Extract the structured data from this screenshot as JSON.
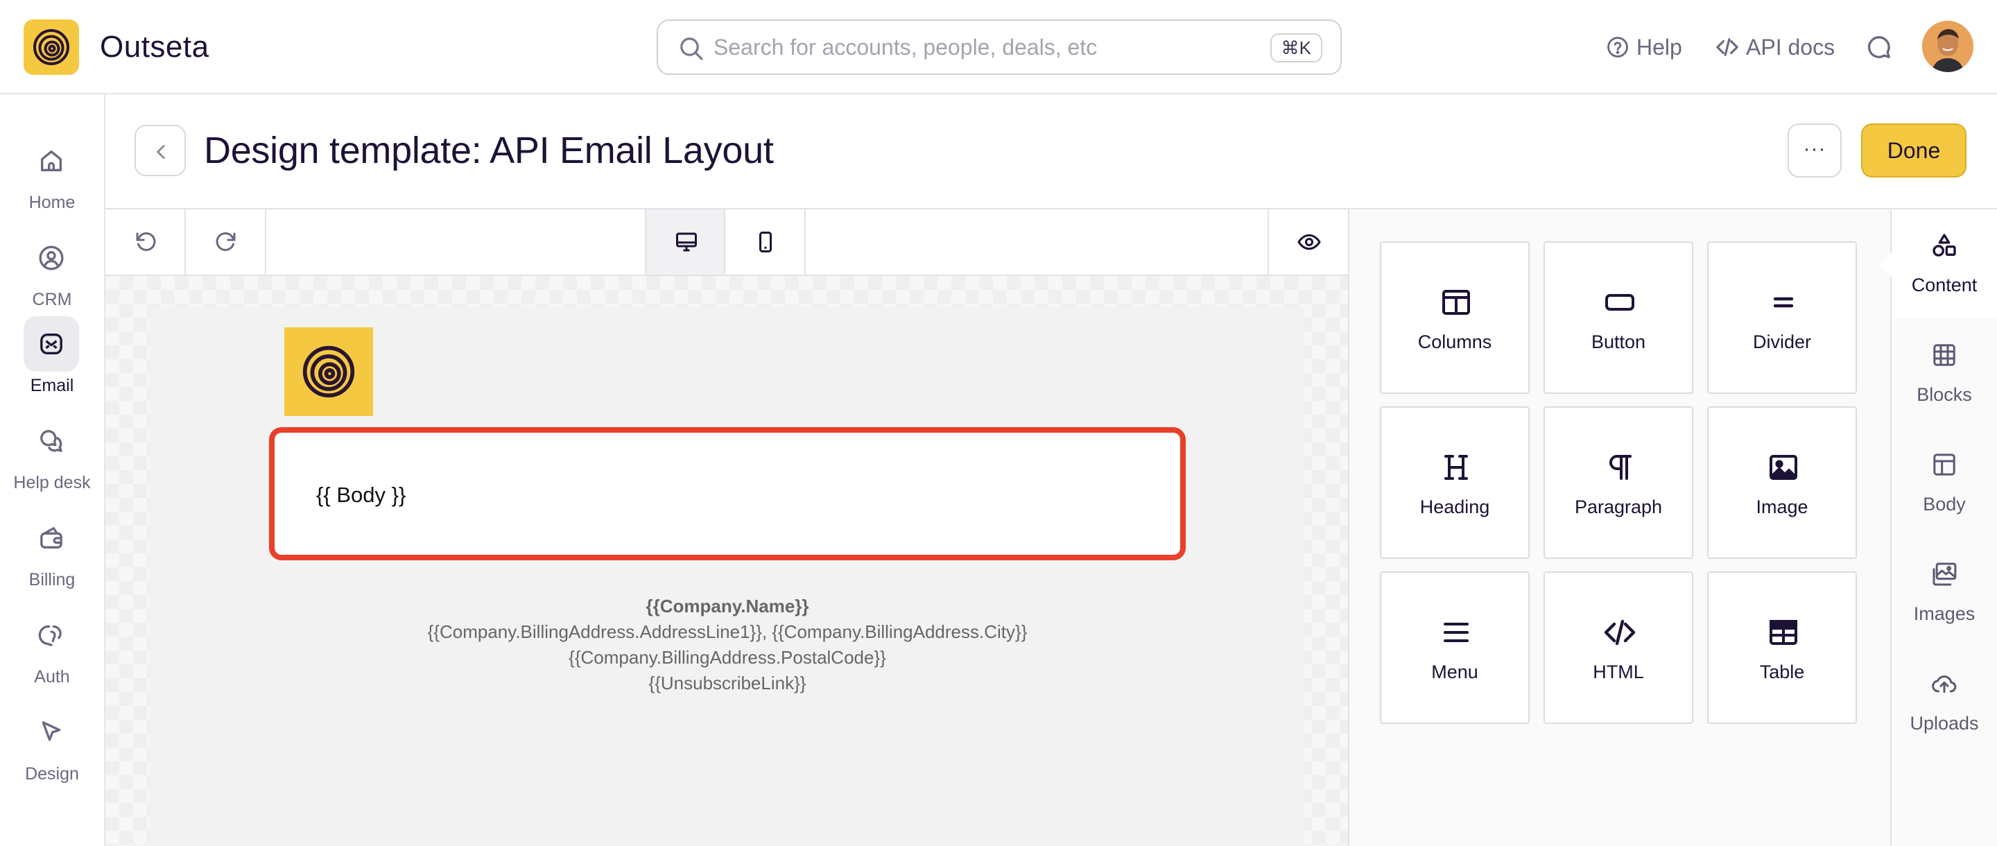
{
  "app": {
    "name": "Outseta",
    "logo_icon": "outseta-logo-icon"
  },
  "search": {
    "placeholder": "Search for accounts, people, deals, etc",
    "shortcut": "⌘K"
  },
  "top_links": {
    "help": "Help",
    "api_docs": "API docs"
  },
  "nav": {
    "items": [
      {
        "label": "Home",
        "icon": "home-icon"
      },
      {
        "label": "CRM",
        "icon": "crm-icon"
      },
      {
        "label": "Email",
        "icon": "email-icon",
        "active": true
      },
      {
        "label": "Help desk",
        "icon": "help-desk-icon"
      },
      {
        "label": "Billing",
        "icon": "billing-icon"
      },
      {
        "label": "Auth",
        "icon": "auth-icon"
      },
      {
        "label": "Design",
        "icon": "design-icon"
      }
    ]
  },
  "page": {
    "title": "Design template: API Email Layout",
    "more_label": "···",
    "done_label": "Done"
  },
  "editor": {
    "view_mode": "desktop",
    "body_placeholder": "{{ Body }}",
    "footer": {
      "company_name": "{{Company.Name}}",
      "address_line": "{{Company.BillingAddress.AddressLine1}}, {{Company.BillingAddress.City}}",
      "postal_code": "{{Company.BillingAddress.PostalCode}}",
      "unsubscribe": "{{UnsubscribeLink}}"
    }
  },
  "content_tiles": [
    {
      "label": "Columns",
      "icon": "columns-icon"
    },
    {
      "label": "Button",
      "icon": "button-icon"
    },
    {
      "label": "Divider",
      "icon": "divider-icon"
    },
    {
      "label": "Heading",
      "icon": "heading-icon"
    },
    {
      "label": "Paragraph",
      "icon": "paragraph-icon"
    },
    {
      "label": "Image",
      "icon": "image-icon"
    },
    {
      "label": "Menu",
      "icon": "menu-icon"
    },
    {
      "label": "HTML",
      "icon": "html-icon"
    },
    {
      "label": "Table",
      "icon": "table-icon"
    }
  ],
  "rail": {
    "items": [
      {
        "label": "Content",
        "icon": "shapes-icon",
        "active": true
      },
      {
        "label": "Blocks",
        "icon": "blocks-icon"
      },
      {
        "label": "Body",
        "icon": "body-icon"
      },
      {
        "label": "Images",
        "icon": "images-icon"
      },
      {
        "label": "Uploads",
        "icon": "upload-cloud-icon"
      }
    ]
  },
  "colors": {
    "brand_yellow": "#f5c842",
    "selection_red": "#e8402a",
    "text_dark": "#1d1236"
  }
}
